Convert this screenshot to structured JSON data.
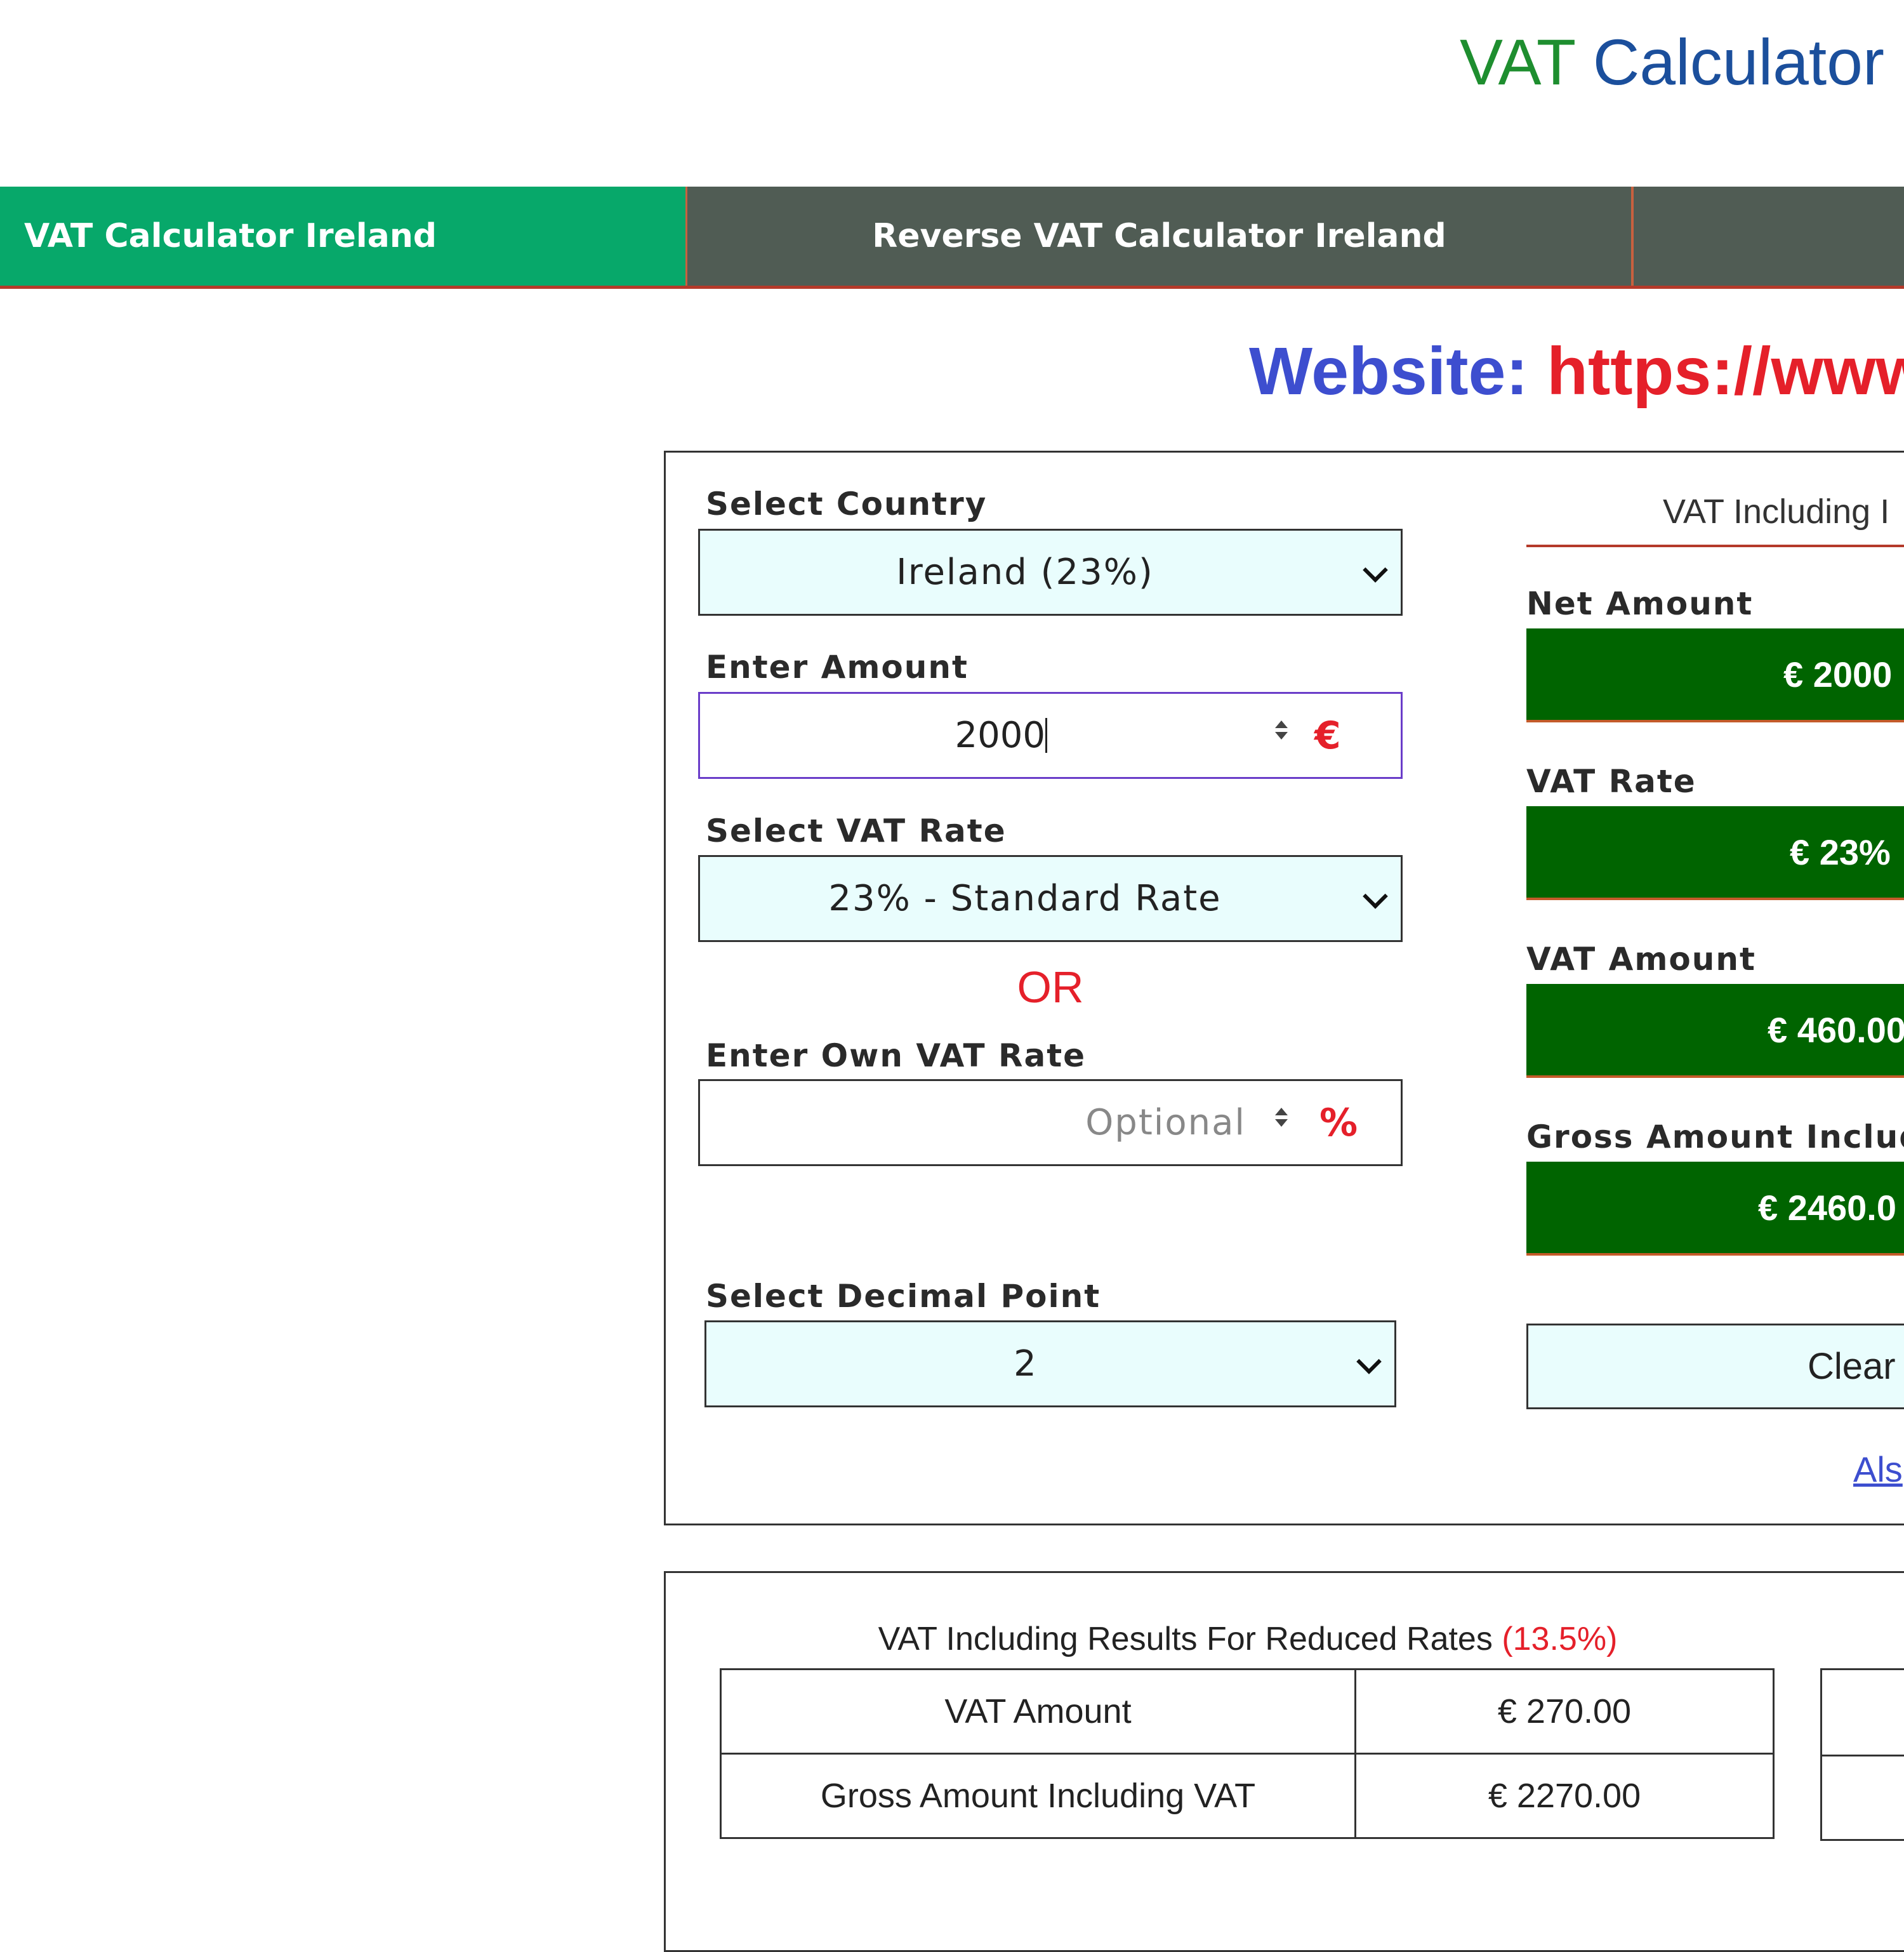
{
  "header": {
    "title_part1": "VAT",
    "title_part2": "Calculator"
  },
  "tabs": [
    {
      "label": "VAT Calculator Ireland",
      "active": true
    },
    {
      "label": "Reverse VAT Calculator Ireland",
      "active": false
    },
    {
      "label": "",
      "active": false
    }
  ],
  "website": {
    "label": "Website:",
    "url": "https://www."
  },
  "form": {
    "country_label": "Select Country",
    "country_value": "Ireland (23%)",
    "amount_label": "Enter Amount",
    "amount_value": "2000",
    "amount_currency": "€",
    "vat_rate_label": "Select VAT Rate",
    "vat_rate_value": "23% - Standard Rate",
    "or_text": "OR",
    "own_rate_label": "Enter Own VAT Rate",
    "own_rate_placeholder": "Optional",
    "own_rate_unit": "%",
    "decimal_label": "Select Decimal Point",
    "decimal_value": "2"
  },
  "results": {
    "heading": "VAT Including I",
    "net_label": "Net Amount",
    "net_value": "€ 2000",
    "rate_label": "VAT Rate",
    "rate_value": "€ 23%",
    "vat_label": "VAT Amount",
    "vat_value": "€ 460.00",
    "gross_label": "Gross Amount Includi",
    "gross_value": "€ 2460.0",
    "clear_label": "Clear",
    "also_link": "Als"
  },
  "reduced": {
    "heading": "VAT Including Results For Reduced Rates",
    "rate": "(13.5%)",
    "rows": [
      {
        "label": "VAT Amount",
        "value": "€ 270.00"
      },
      {
        "label": "Gross Amount Including VAT",
        "value": "€ 2270.00"
      }
    ]
  },
  "colors": {
    "title_green": "#1e8e2f",
    "title_blue": "#1b4f9c",
    "active_tab": "#07a86a",
    "tab_bar": "#505c54",
    "result_green": "#006400",
    "accent_red": "#e5202a",
    "link_blue": "#3d4ecf"
  }
}
